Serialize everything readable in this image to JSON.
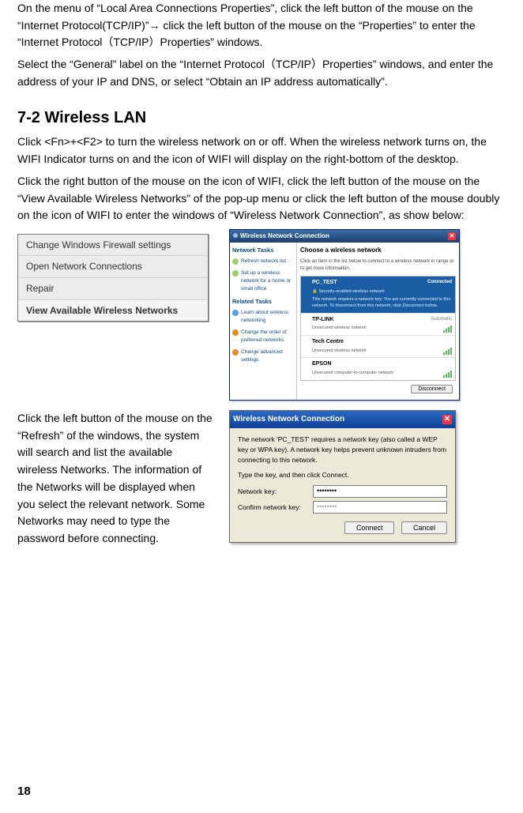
{
  "paragraphs": {
    "p1": "On the menu of “Local Area Connections Properties”, click the left button of the mouse on the “Internet Protocol(TCP/IP)”→ click the left button of the mouse on the “Properties” to enter the “Internet Protocol（TCP/IP）Properties” windows.",
    "p2": "Select the “General” label on the “Internet Protocol（TCP/IP）Properties” windows, and enter the address of your IP and DNS, or select “Obtain an IP address automatically”.",
    "p3": "Click <Fn>+<F2> to turn the wireless network on or off. When the wireless network turns on, the WIFI Indicator turns on and the icon of WIFI will display on the right-bottom of the desktop.",
    "p4": "Click the right button of the mouse on the icon of WIFI, click the left button of the mouse on the “View Available Wireless Networks” of the pop-up menu or click the left button of the mouse doubly on the icon of WIFI to enter the windows of “Wireless Network Connection”, as show below:",
    "p5": "Click the left button of the mouse on the “Refresh” of the windows, the system will search and list the available wireless Networks. The information of the Networks will be displayed when you select the relevant network. Some Networks may need to type the password before connecting."
  },
  "section_heading": "7-2 Wireless LAN",
  "context_menu": {
    "items": [
      "Change Windows Firewall settings",
      "Open Network Connections",
      "Repair",
      "View Available Wireless Networks"
    ]
  },
  "wnc": {
    "title": "Wireless Network Connection",
    "sidebar": {
      "group1_hdr": "Network Tasks",
      "link1": "Refresh network list",
      "link2": "Set up a wireless network for a home or small office",
      "group2_hdr": "Related Tasks",
      "link3": "Learn about wireless networking",
      "link4": "Change the order of preferred networks",
      "link5": "Change advanced settings"
    },
    "main": {
      "choose": "Choose a wireless network",
      "intro": "Click an item in the list below to connect to a wireless network in range or to get more information.",
      "networks": [
        {
          "name": "PC_TEST",
          "sub1": "Security-enabled wireless network",
          "sub2": "This network requires a network key. You are currently connected to this network. To disconnect from this network, click Disconnect below.",
          "right": "Connected"
        },
        {
          "name": "TP-LINK",
          "sub1": "Unsecured wireless network",
          "right": "Automatic"
        },
        {
          "name": "Tech Centre",
          "sub1": "Unsecured wireless network",
          "right": ""
        },
        {
          "name": "EPSON",
          "sub1": "Unsecured computer-to-computer network",
          "right": ""
        }
      ],
      "button": "Disconnect"
    }
  },
  "dialog": {
    "title": "Wireless Network Connection",
    "msg1": "The network 'PC_TEST' requires a network key (also called a WEP key or WPA key). A network key helps prevent unknown intruders from connecting to this network.",
    "msg2": "Type the key, and then click Connect.",
    "label1": "Network key:",
    "label2": "Confirm network key:",
    "value1": "••••••••",
    "value2": "••••••••",
    "btn_connect": "Connect",
    "btn_cancel": "Cancel"
  },
  "page_number": "18"
}
